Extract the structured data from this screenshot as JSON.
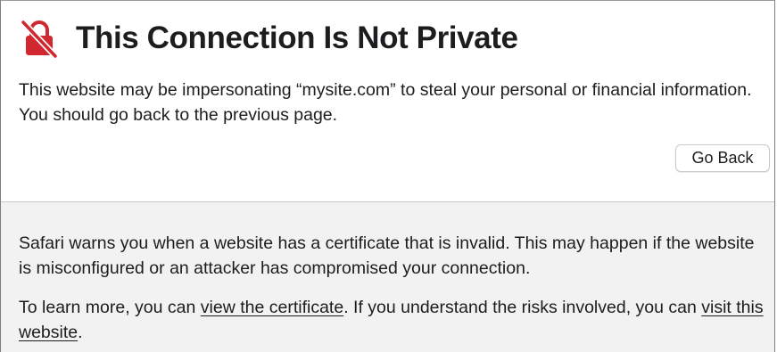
{
  "header": {
    "icon": "lock-slash-icon",
    "icon_color": "#d0282e",
    "title": "This Connection Is Not Private"
  },
  "intro": {
    "text": "This website may be impersonating “mysite.com” to steal your personal or financial information. You should go back to the previous page."
  },
  "actions": {
    "go_back_label": "Go Back"
  },
  "details": {
    "paragraph1": "Safari warns you when a website has a certificate that is invalid. This may happen if the website is misconfigured or an attacker has compromised your connection.",
    "paragraph2": {
      "prefix": "To learn more, you can ",
      "certificate_link": "view the certificate",
      "middle": ". If you understand the risks involved, you can ",
      "visit_link": "visit this website",
      "suffix": "."
    }
  },
  "colors": {
    "top_background": "#ffffff",
    "bottom_background": "#f2f2f2",
    "text": "#1d1d1f"
  }
}
